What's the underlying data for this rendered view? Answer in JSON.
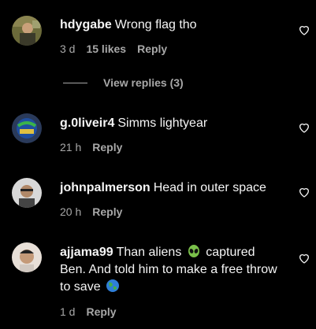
{
  "comments": [
    {
      "username": "hdygabe",
      "text": "Wrong flag tho",
      "time": "3 d",
      "likes": "15 likes",
      "reply_label": "Reply",
      "avatar_icon": "profile-photo"
    },
    {
      "username": "g.0liveir4",
      "text": "Simms lightyear",
      "time": "21 h",
      "reply_label": "Reply",
      "avatar_icon": "profile-photo"
    },
    {
      "username": "johnpalmerson",
      "text": "Head in outer space",
      "time": "20 h",
      "reply_label": "Reply",
      "avatar_icon": "profile-photo"
    },
    {
      "username": "ajjama99",
      "text_part1": "Than aliens",
      "text_part2": "captured Ben. And told him to make a free throw to save",
      "time": "1 d",
      "reply_label": "Reply",
      "avatar_icon": "profile-photo",
      "emoji_1": "alien-emoji",
      "emoji_2": "globe-emoji"
    }
  ],
  "view_replies_label": "View replies (3)",
  "colors": {
    "background": "#000000",
    "text": "#f5f5f5",
    "secondary": "#a8a8a8"
  }
}
